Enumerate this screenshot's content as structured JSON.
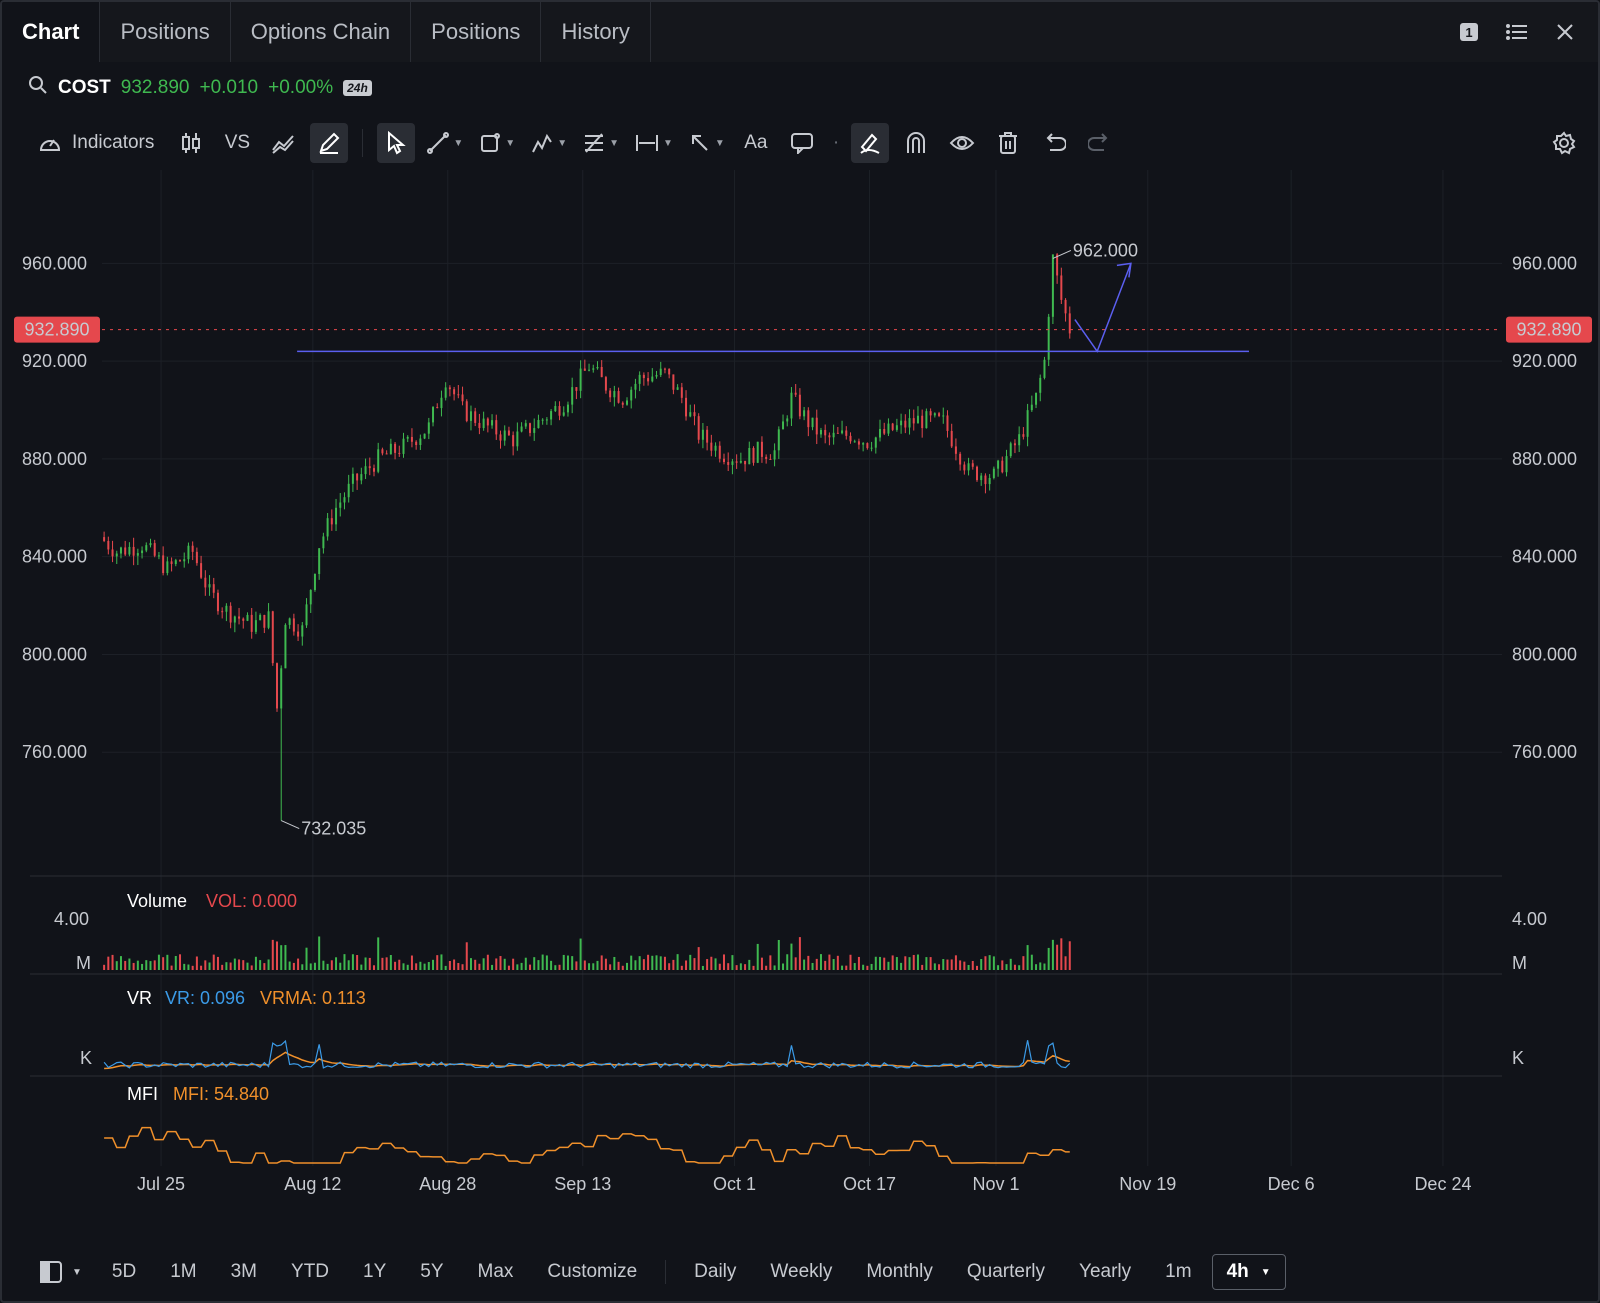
{
  "tabs": [
    {
      "label": "Chart",
      "active": true
    },
    {
      "label": "Positions",
      "active": false
    },
    {
      "label": "Options Chain",
      "active": false
    },
    {
      "label": "Positions",
      "active": false
    },
    {
      "label": "History",
      "active": false
    }
  ],
  "window_controls": {
    "badge": "1",
    "icons": [
      "layout-1-icon",
      "list-icon",
      "close-icon"
    ]
  },
  "symbol": {
    "ticker": "COST",
    "price": "932.890",
    "change": "+0.010",
    "change_pct": "+0.00%",
    "session_badge": "24h"
  },
  "toolbar": {
    "indicators_label": "Indicators",
    "vs_label": "VS",
    "text_tool_label": "Aa",
    "icons": [
      "candles-icon",
      "compare-icon",
      "line-chart-icon",
      "pencil-icon",
      "cursor-icon",
      "trendline-icon",
      "shape-icon",
      "pattern-icon",
      "fib-icon",
      "measure-icon",
      "arrow-icon",
      "text-icon",
      "comment-icon",
      "magnet-draw-icon",
      "magnet-icon",
      "eye-icon",
      "trash-icon",
      "undo-icon",
      "redo-icon",
      "settings-icon"
    ]
  },
  "colors": {
    "up": "#3fb950",
    "down": "#e5484d",
    "price_line": "#e5484d",
    "drawing": "#5b5ff0",
    "vr_line": "#3b9be8",
    "vrma_line": "#f0902b",
    "mfi_line": "#f0902b",
    "vol_label": "#e5484d",
    "grid": "#1d2027"
  },
  "chart_data": {
    "type": "candlestick",
    "interval": "4h",
    "y_ticks": [
      "960.000",
      "920.000",
      "880.000",
      "840.000",
      "800.000",
      "760.000"
    ],
    "ylim": [
      720,
      990
    ],
    "x_ticks": [
      "Jul 25",
      "Aug 12",
      "Aug 28",
      "Sep 13",
      "Oct 1",
      "Oct 17",
      "Nov 1",
      "Nov 19",
      "Dec 6",
      "Dec 24"
    ],
    "last_price_label": "932.890",
    "annotations": {
      "high": "962.000",
      "low": "732.035"
    },
    "drawings": {
      "support_level": 924,
      "projection_target": 960
    },
    "price_path": [
      [
        "Jul 18",
        848
      ],
      [
        "Jul 20",
        842
      ],
      [
        "Jul 23",
        845
      ],
      [
        "Jul 26",
        835
      ],
      [
        "Jul 29",
        842
      ],
      [
        "Jul 31",
        825
      ],
      [
        "Aug 2",
        818
      ],
      [
        "Aug 5",
        812
      ],
      [
        "Aug 7",
        815
      ],
      [
        "Aug 8",
        778
      ],
      [
        "Aug 9",
        815
      ],
      [
        "Aug 11",
        810
      ],
      [
        "Aug 13",
        845
      ],
      [
        "Aug 15",
        860
      ],
      [
        "Aug 17",
        870
      ],
      [
        "Aug 20",
        880
      ],
      [
        "Aug 23",
        885
      ],
      [
        "Aug 26",
        893
      ],
      [
        "Aug 28",
        913
      ],
      [
        "Aug 30",
        900
      ],
      [
        "Sep 2",
        893
      ],
      [
        "Sep 5",
        888
      ],
      [
        "Sep 8",
        895
      ],
      [
        "Sep 11",
        903
      ],
      [
        "Sep 14",
        918
      ],
      [
        "Sep 16",
        910
      ],
      [
        "Sep 18",
        905
      ],
      [
        "Sep 20",
        913
      ],
      [
        "Sep 23",
        915
      ],
      [
        "Sep 25",
        905
      ],
      [
        "Sep 27",
        890
      ],
      [
        "Sep 30",
        882
      ],
      [
        "Oct 2",
        880
      ],
      [
        "Oct 4",
        883
      ],
      [
        "Oct 6",
        883
      ],
      [
        "Oct 8",
        905
      ],
      [
        "Oct 10",
        895
      ],
      [
        "Oct 12",
        888
      ],
      [
        "Oct 15",
        890
      ],
      [
        "Oct 17",
        887
      ],
      [
        "Oct 20",
        892
      ],
      [
        "Oct 23",
        896
      ],
      [
        "Oct 26",
        895
      ],
      [
        "Oct 29",
        875
      ],
      [
        "Nov 1",
        873
      ],
      [
        "Nov 4",
        888
      ],
      [
        "Nov 6",
        905
      ],
      [
        "Nov 7",
        920
      ],
      [
        "Nov 8",
        962
      ],
      [
        "Nov 9",
        945
      ],
      [
        "Nov 10",
        933
      ]
    ],
    "volume": {
      "label": "Volume",
      "vol_label": "VOL: 0.000",
      "axis_top": "4.00",
      "axis_unit": "M"
    },
    "vr": {
      "label": "VR",
      "vr_label": "VR: 0.096",
      "vrma_label": "VRMA: 0.113",
      "axis_unit": "K"
    },
    "mfi": {
      "label": "MFI",
      "mfi_label": "MFI: 54.840"
    }
  },
  "periods": [
    "5D",
    "1M",
    "3M",
    "YTD",
    "1Y",
    "5Y",
    "Max",
    "Customize"
  ],
  "intervals": [
    "Daily",
    "Weekly",
    "Monthly",
    "Quarterly",
    "Yearly",
    "1m"
  ],
  "selected_interval": "4h"
}
